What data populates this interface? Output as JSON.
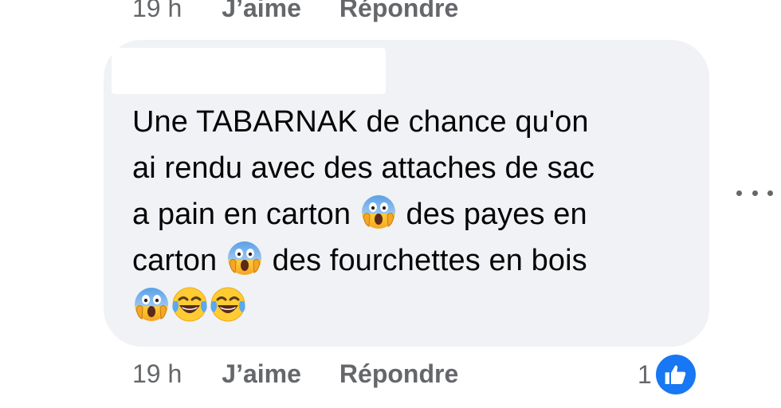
{
  "previous_comment_actions": {
    "time": "19 h",
    "like_label": "J’aime",
    "reply_label": "Répondre"
  },
  "comment": {
    "text_line1": "Une TABARNAK de chance qu'on",
    "text_line2": "ai rendu avec des attaches de sac",
    "text_line3a": "a pain en carton",
    "text_line3b": "des payes en",
    "text_line4a": "carton",
    "text_line4b": "des fourchettes en bois",
    "emojis": [
      "face-screaming-in-fear",
      "face-with-tears-of-joy"
    ]
  },
  "comment_actions": {
    "time": "19 h",
    "like_label": "J’aime",
    "reply_label": "Répondre"
  },
  "reactions": {
    "count": "1",
    "type": "like",
    "color": "#1877f2"
  },
  "colors": {
    "bubble": "#f0f2f5",
    "secondary_text": "#65676b",
    "primary_text": "#050505"
  }
}
